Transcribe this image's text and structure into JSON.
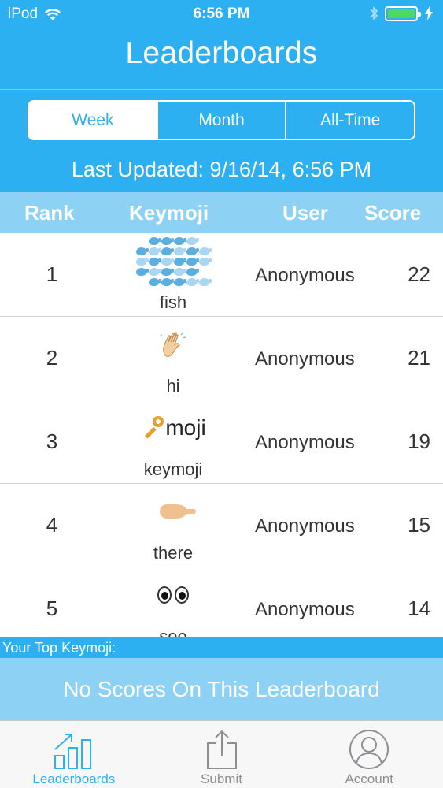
{
  "status_bar": {
    "carrier": "iPod",
    "time": "6:56 PM"
  },
  "header": {
    "title": "Leaderboards"
  },
  "segments": [
    {
      "label": "Week",
      "active": true
    },
    {
      "label": "Month",
      "active": false
    },
    {
      "label": "All-Time",
      "active": false
    }
  ],
  "last_updated": "Last Updated: 9/16/14, 6:56 PM",
  "table": {
    "columns": {
      "rank": "Rank",
      "keymoji": "Keymoji",
      "user": "User",
      "score": "Score"
    },
    "rows": [
      {
        "rank": "1",
        "keymoji_icon": "whale-grid-icon",
        "word": "fish",
        "user": "Anonymous",
        "score": "22"
      },
      {
        "rank": "2",
        "keymoji_icon": "waving-hand-icon",
        "word": "hi",
        "user": "Anonymous",
        "score": "21"
      },
      {
        "rank": "3",
        "keymoji_icon": "key-icon",
        "emoji_text": "moji",
        "word": "keymoji",
        "user": "Anonymous",
        "score": "19"
      },
      {
        "rank": "4",
        "keymoji_icon": "pointing-hand-icon",
        "word": "there",
        "user": "Anonymous",
        "score": "15"
      },
      {
        "rank": "5",
        "keymoji_icon": "eyes-icon",
        "word": "see",
        "user": "Anonymous",
        "score": "14"
      }
    ]
  },
  "your_top": {
    "label": "Your Top Keymoji:",
    "empty_message": "No Scores On This Leaderboard"
  },
  "tab_bar": [
    {
      "label": "Leaderboards",
      "icon": "bar-chart-icon",
      "active": true
    },
    {
      "label": "Submit",
      "icon": "share-icon",
      "active": false
    },
    {
      "label": "Account",
      "icon": "person-icon",
      "active": false
    }
  ],
  "colors": {
    "accent": "#2db0f2",
    "header_light": "#8dd1f4",
    "battery": "#4cd964"
  }
}
